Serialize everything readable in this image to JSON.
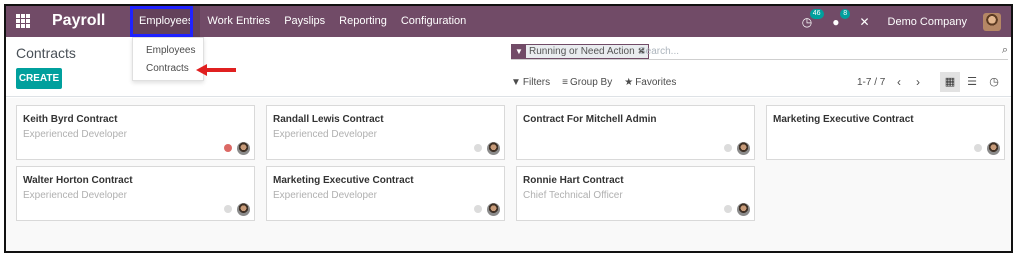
{
  "navbar": {
    "app_name": "Payroll",
    "menu": [
      {
        "label": "Employees"
      },
      {
        "label": "Work Entries"
      },
      {
        "label": "Payslips"
      },
      {
        "label": "Reporting"
      },
      {
        "label": "Configuration"
      }
    ],
    "activity_count": "46",
    "message_count": "8",
    "company": "Demo Company",
    "bg_color": "#714b67"
  },
  "dropdown": {
    "items": [
      {
        "label": "Employees"
      },
      {
        "label": "Contracts"
      }
    ]
  },
  "control_panel": {
    "breadcrumb": "Contracts",
    "create_label": "CREATE",
    "search": {
      "facet": "Running or Need Action",
      "placeholder": "Search..."
    },
    "filters_label": "Filters",
    "group_by_label": "Group By",
    "favorites_label": "Favorites",
    "pager": "1-7 / 7"
  },
  "kanban": {
    "cards": [
      {
        "title": "Keith Byrd Contract",
        "subtitle": "Experienced Developer",
        "status": "red"
      },
      {
        "title": "Randall Lewis Contract",
        "subtitle": "Experienced Developer",
        "status": "grey"
      },
      {
        "title": "Contract For Mitchell Admin",
        "subtitle": "",
        "status": "grey"
      },
      {
        "title": "Marketing Executive Contract",
        "subtitle": "",
        "status": "grey"
      },
      {
        "title": "Walter Horton Contract",
        "subtitle": "Experienced Developer",
        "status": "grey"
      },
      {
        "title": "Marketing Executive Contract",
        "subtitle": "Experienced Developer",
        "status": "grey"
      },
      {
        "title": "Ronnie Hart Contract",
        "subtitle": "Chief Technical Officer",
        "status": "grey"
      }
    ]
  },
  "colors": {
    "accent": "#00a09d",
    "highlight": "#1f22ff",
    "arrow": "#e02020"
  }
}
